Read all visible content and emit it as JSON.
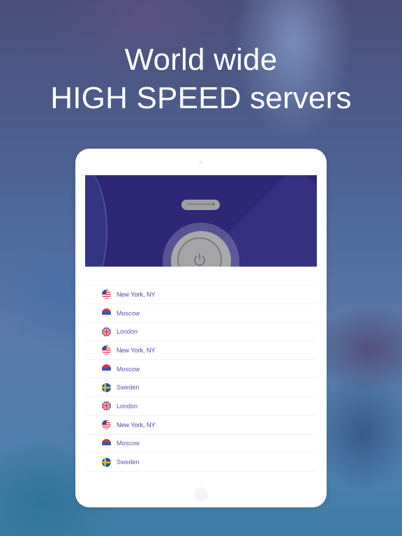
{
  "headline": {
    "line1": "World wide",
    "line2": "HIGH SPEED servers"
  },
  "app": {
    "status": "Disconnected",
    "power_button": {
      "icon": "power-icon",
      "state": "off"
    },
    "colors": {
      "header_bg": "#2d2775",
      "server_text": "#5b56a8",
      "status_pill": "#a1a1a4"
    },
    "servers": [
      {
        "name": "New York, NY",
        "flag": "us-flag-icon"
      },
      {
        "name": "Moscow",
        "flag": "ru-flag-icon"
      },
      {
        "name": "London",
        "flag": "uk-flag-icon"
      },
      {
        "name": "New York, NY",
        "flag": "us-flag-icon"
      },
      {
        "name": "Moscow",
        "flag": "ru-flag-icon"
      },
      {
        "name": "Sweden",
        "flag": "se-flag-icon"
      },
      {
        "name": "London",
        "flag": "uk-flag-icon"
      },
      {
        "name": "New York, NY",
        "flag": "us-flag-icon"
      },
      {
        "name": "Moscow",
        "flag": "ru-flag-icon"
      },
      {
        "name": "Sweden",
        "flag": "se-flag-icon"
      }
    ]
  }
}
